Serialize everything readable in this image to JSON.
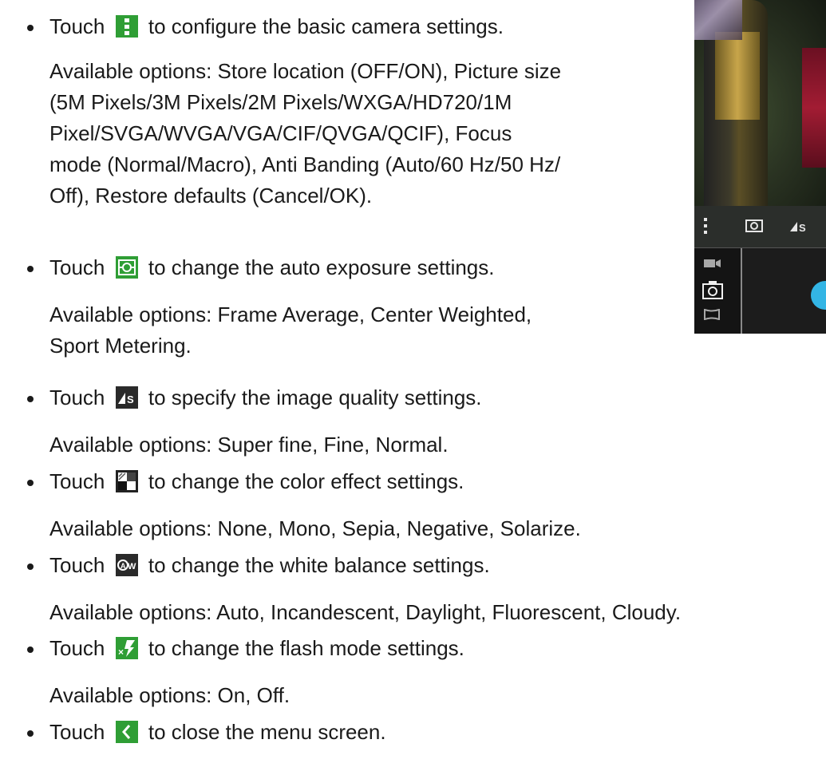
{
  "items": [
    {
      "intro": "Touch",
      "icon": "overflow-menu-icon",
      "text": "to configure the basic camera settings.",
      "details": [
        "Available options: Store location (OFF/ON), Picture size",
        "(5M Pixels/3M Pixels/2M Pixels/WXGA/HD720/1M",
        "Pixel/SVGA/WVGA/VGA/CIF/QVGA/QCIF), Focus",
        "mode (Normal/Macro), Anti Banding (Auto/60 Hz/50 Hz/",
        "Off), Restore defaults (Cancel/OK)."
      ]
    },
    {
      "intro": "Touch",
      "icon": "auto-exposure-icon",
      "text": "to change the auto exposure settings.",
      "details": [
        "Available options: Frame Average, Center Weighted,",
        "Sport Metering."
      ]
    },
    {
      "intro": "Touch",
      "icon": "image-quality-icon",
      "text": "to specify the image quality settings.",
      "details": [
        "Available options: Super fine, Fine, Normal."
      ]
    },
    {
      "intro": "Touch",
      "icon": "color-effect-icon",
      "text": "to change the color effect settings.",
      "details": [
        "Available options: None, Mono, Sepia, Negative, Solarize."
      ]
    },
    {
      "intro": "Touch",
      "icon": "white-balance-icon",
      "text": "to change the white balance settings.",
      "details": [
        "Available options: Auto, Incandescent, Daylight, Fluorescent, Cloudy."
      ]
    },
    {
      "intro": "Touch",
      "icon": "flash-off-icon",
      "text": "to change the flash mode settings.",
      "details": [
        "Available options: On, Off."
      ]
    },
    {
      "intro": "Touch",
      "icon": "back-chevron-icon",
      "text": "to close the menu screen.",
      "details": []
    }
  ],
  "screenshot": {
    "toolbar_icons": [
      "overflow-menu-icon",
      "auto-exposure-icon",
      "image-quality-icon"
    ],
    "mode_icons": [
      "video-icon",
      "camera-icon",
      "panorama-icon"
    ],
    "accent_color": "#33b5e5"
  }
}
